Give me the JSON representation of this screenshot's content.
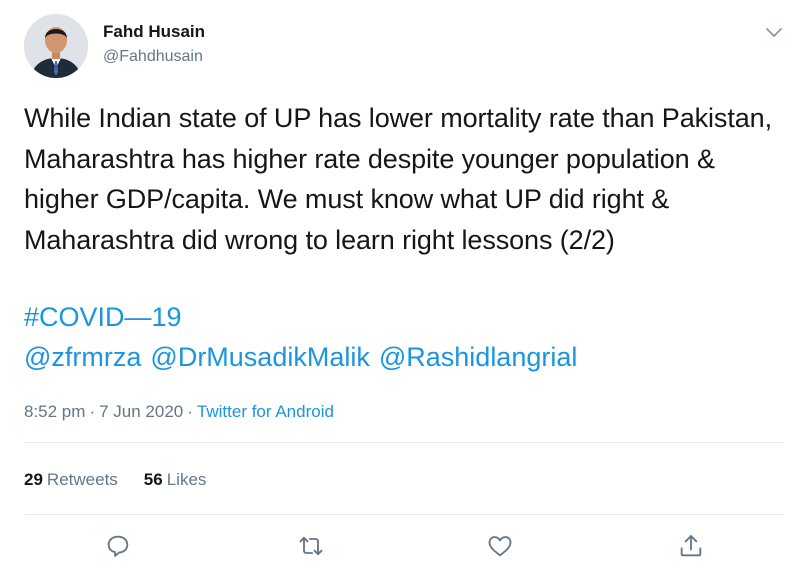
{
  "author": {
    "name": "Fahd Husain",
    "handle": "@Fahdhusain"
  },
  "tweet": {
    "text": "While Indian state of UP has lower mortality rate than Pakistan, Maharashtra has higher rate despite younger population & higher GDP/capita. We must know what UP did right & Maharashtra did wrong to learn right lessons (2/2)",
    "hashtag": "#COVID—19",
    "mentions": [
      "@zfrmrza",
      "@DrMusadikMalik",
      "@Rashidlangrial"
    ]
  },
  "meta": {
    "time": "8:52 pm",
    "separator1": "·",
    "date": "7 Jun 2020",
    "separator2": "·",
    "source": "Twitter for Android"
  },
  "stats": {
    "retweets_count": "29",
    "retweets_label": "Retweets",
    "likes_count": "56",
    "likes_label": "Likes"
  },
  "icons": {
    "caret": "chevron-down-icon",
    "reply": "reply-icon",
    "retweet": "retweet-icon",
    "like": "heart-icon",
    "share": "share-icon"
  },
  "colors": {
    "link": "#1b95e0",
    "secondary_text": "#657786",
    "primary_text": "#14171a",
    "divider": "#e6ecf0"
  }
}
